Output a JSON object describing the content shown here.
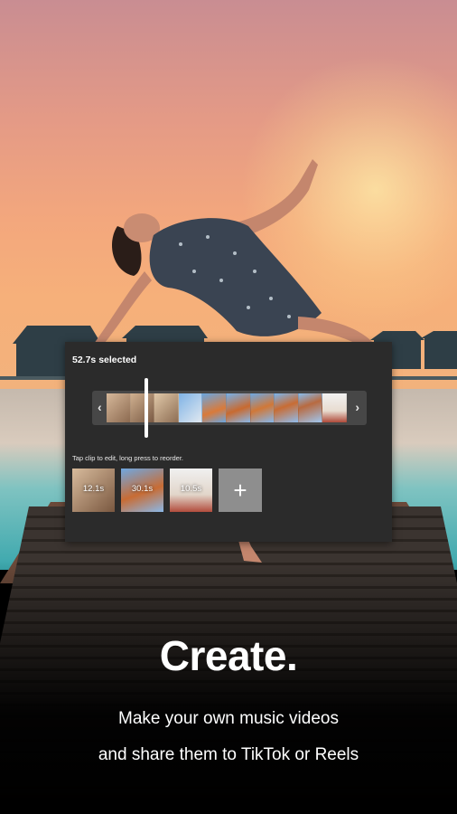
{
  "editor": {
    "selected_label": "52.7s selected",
    "timeline_left_arrow": "‹",
    "timeline_right_arrow": "›",
    "hint": "Tap clip to edit, long press to reorder.",
    "clips": [
      {
        "duration": "12.1s"
      },
      {
        "duration": "30.1s"
      },
      {
        "duration": "10.5s"
      }
    ],
    "add_symbol": "+"
  },
  "marketing": {
    "headline": "Create.",
    "line1": "Make your own music videos",
    "line2": "and share them to TikTok or Reels"
  },
  "icons": {
    "timeline_left": "chevron-left-icon",
    "timeline_right": "chevron-right-icon",
    "add": "plus-icon"
  },
  "colors": {
    "panel_bg": "#2b2b2b",
    "add_button_bg": "#8e8e8e",
    "text": "#ffffff"
  }
}
